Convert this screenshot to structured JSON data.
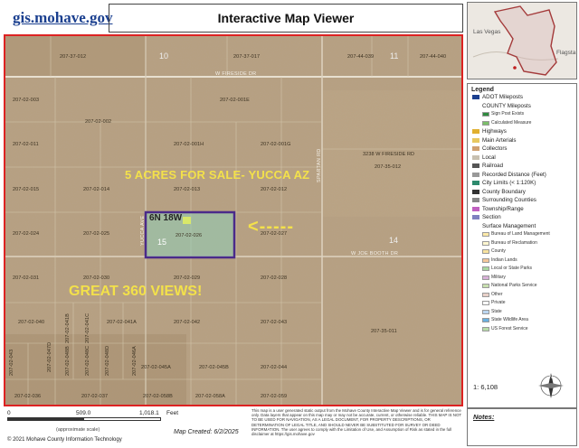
{
  "header": {
    "logo": "gis.mohave.gov",
    "title": "Interactive Map Viewer"
  },
  "map": {
    "section_numbers": [
      "10",
      "11",
      "15",
      "14"
    ],
    "roads": [
      "W FIRESIDE DR",
      "W JOE BOOTH DR",
      "SPARTAN RD",
      "YUCCA AVE"
    ],
    "township": "6N 18W",
    "overlay_title": "5 ACRES FOR SALE- YUCCA AZ",
    "overlay_views": "GREAT 360 VIEWS!",
    "overlay_arrow": "<-----",
    "parcel_labels": [
      "207-37-012",
      "207-37-017",
      "207-44-039",
      "207-44-040",
      "207-02-003",
      "207-02-001E",
      "207-02-002",
      "207-02-011",
      "207-02-001H",
      "207-02-001G",
      "3238 W FIRESIDE RD",
      "207-35-012",
      "207-02-015",
      "207-02-014",
      "207-02-013",
      "207-02-012",
      "207-02-024",
      "207-02-025",
      "207-02-026",
      "207-02-027",
      "207-02-031",
      "207-02-030",
      "207-02-029",
      "207-02-028",
      "207-02-040",
      "207-02-041A",
      "207-02-041B",
      "207-02-041C",
      "207-02-042",
      "207-02-043",
      "207-35-011",
      "207-02-045A",
      "207-02-045B",
      "207-02-044",
      "207-02-036",
      "207-02-037",
      "207-02-058B",
      "207-02-058A",
      "207-02-059",
      "207-02-043",
      "207-02-047D",
      "207-02-048B",
      "207-02-048C",
      "207-02-048D",
      "207-02-046A"
    ]
  },
  "footer": {
    "scale_labels": [
      "0",
      "509.0",
      "1,018.1",
      "Feet"
    ],
    "approx": "(approximate scale)",
    "copyright": "© 2021 Mohave County Information Technology",
    "created": "Map Created: 6/2/2025",
    "disclaimer": "This map is a user generated static output from the Mohave County Interactive Map Viewer and is for general reference only. Data layers that appear on this map may or may not be accurate, current, or otherwise reliable. THIS MAP IS NOT TO BE USED FOR NAVIGATION, AS A LEGAL DOCUMENT, FOR PROPERTY DESCRIPTIONS, OR DETERMINATION OF LEGAL TITLE, AND SHOULD NEVER BE SUBSTITUTED FOR SURVEY OR DEED INFORMATION. The user agrees to comply with the Limitation of Use, and Assumption of Risk as stated in the full disclaimer at https://gis.mohave.gov"
  },
  "overview_map": {
    "label": "Las Vegas",
    "label2": "Flagsta"
  },
  "legend": {
    "title": "Legend",
    "items": [
      {
        "label": "ADOT Mileposts",
        "indent": 0,
        "color": "#1b3f8f"
      },
      {
        "label": "COUNTY Mileposts",
        "indent": 0,
        "color": ""
      },
      {
        "label": "Sign Post Exists",
        "indent": 1,
        "color": "#2e8b3e"
      },
      {
        "label": "Calculated Measure",
        "indent": 1,
        "color": "#7bbf6a"
      },
      {
        "label": "Highways",
        "indent": 0,
        "color": "#e0b030"
      },
      {
        "label": "Main Arterials",
        "indent": 0,
        "color": "#e8c860"
      },
      {
        "label": "Collectors",
        "indent": 0,
        "color": "#d0a070"
      },
      {
        "label": "Local",
        "indent": 0,
        "color": "#c8c0b0"
      },
      {
        "label": "Railroad",
        "indent": 0,
        "color": "#555555"
      },
      {
        "label": "Recorded Distance (Feet)",
        "indent": 0,
        "color": "#999999"
      },
      {
        "label": "City Limits (< 1:120K)",
        "indent": 0,
        "color": "#2d8a6d"
      },
      {
        "label": "County Boundary",
        "indent": 0,
        "color": "#333333"
      },
      {
        "label": "Surrounding Counties",
        "indent": 0,
        "color": "#888888"
      },
      {
        "label": "Township/Range",
        "indent": 0,
        "color": "#c060c0"
      },
      {
        "label": "Section",
        "indent": 0,
        "color": "#8080c0"
      },
      {
        "label": "Surface Management",
        "indent": 0,
        "color": ""
      },
      {
        "label": "Bureau of Land Management",
        "indent": 1,
        "color": "#fde9a8"
      },
      {
        "label": "Bureau of Reclamation",
        "indent": 1,
        "color": "#fff7d0"
      },
      {
        "label": "County",
        "indent": 1,
        "color": "#f8e3a0"
      },
      {
        "label": "Indian Lands",
        "indent": 1,
        "color": "#f4c79a"
      },
      {
        "label": "Local or State Parks",
        "indent": 1,
        "color": "#a8d8a0"
      },
      {
        "label": "Military",
        "indent": 1,
        "color": "#d8b0d8"
      },
      {
        "label": "National Parks Service",
        "indent": 1,
        "color": "#c8e0b0"
      },
      {
        "label": "Other",
        "indent": 1,
        "color": "#e8d0c8"
      },
      {
        "label": "Private",
        "indent": 1,
        "color": "#ffffff"
      },
      {
        "label": "State",
        "indent": 1,
        "color": "#bcd6f0"
      },
      {
        "label": "State Wildlife Area",
        "indent": 1,
        "color": "#6ab0e0"
      },
      {
        "label": "US Forest Service",
        "indent": 1,
        "color": "#b8dca8"
      }
    ],
    "scale": "1: 6,108",
    "notes": "Notes:"
  }
}
